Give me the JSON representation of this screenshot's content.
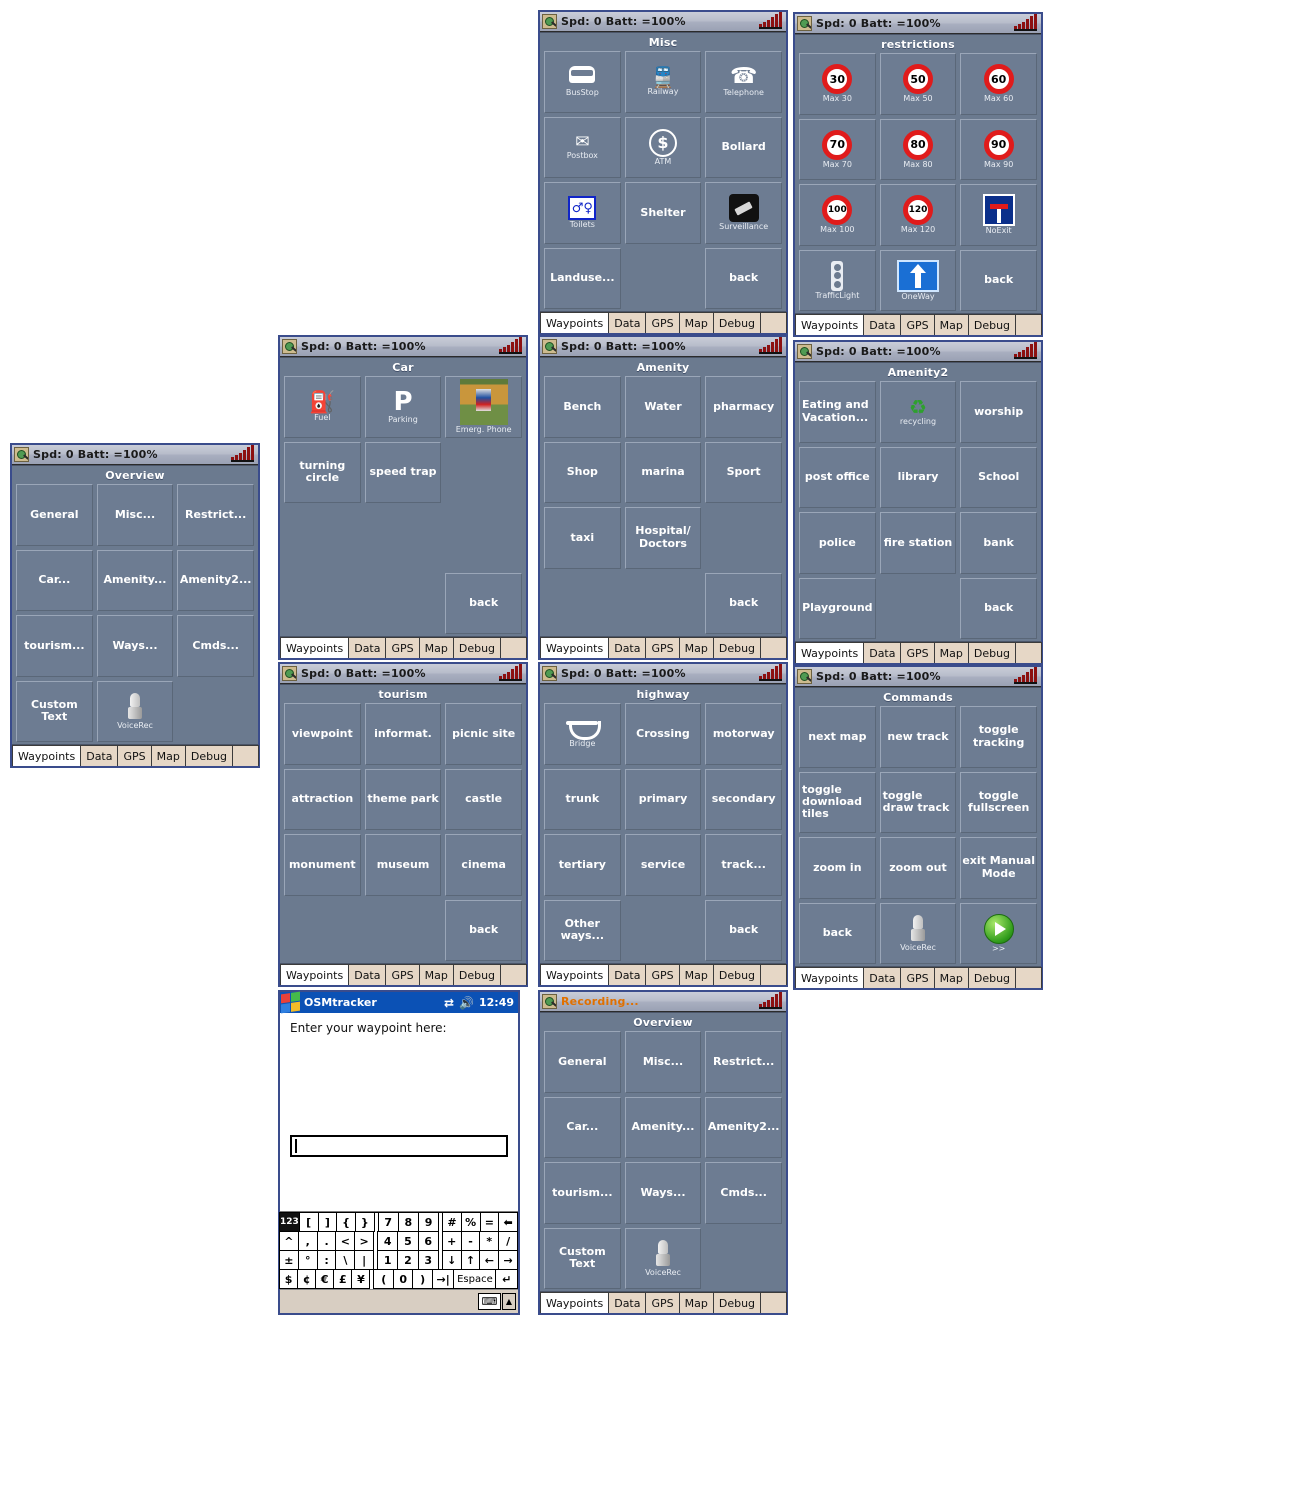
{
  "status": {
    "spd_batt": "Spd: 0 Batt: =100%",
    "recording": "Recording...",
    "signal_icon": "signal-bars-icon",
    "app_icon": "osmtracker-icon"
  },
  "tabs": [
    "Waypoints",
    "Data",
    "GPS",
    "Map",
    "Debug"
  ],
  "panels": {
    "overview": {
      "title": "Overview",
      "buttons": [
        {
          "label": "General"
        },
        {
          "label": "Misc..."
        },
        {
          "label": "Restrict..."
        },
        {
          "label": "Car..."
        },
        {
          "label": "Amenity..."
        },
        {
          "label": "Amenity2..."
        },
        {
          "label": "tourism..."
        },
        {
          "label": "Ways..."
        },
        {
          "label": "Cmds..."
        },
        {
          "label": "Custom Text"
        },
        {
          "label": "",
          "caption": "VoiceRec",
          "icon": "microphone-icon"
        },
        {
          "label": "",
          "empty": true
        }
      ]
    },
    "overview_recording": {
      "title": "Overview",
      "buttons": [
        {
          "label": "General"
        },
        {
          "label": "Misc..."
        },
        {
          "label": "Restrict..."
        },
        {
          "label": "Car..."
        },
        {
          "label": "Amenity..."
        },
        {
          "label": "Amenity2..."
        },
        {
          "label": "tourism..."
        },
        {
          "label": "Ways..."
        },
        {
          "label": "Cmds..."
        },
        {
          "label": "Custom Text"
        },
        {
          "label": "",
          "caption": "VoiceRec",
          "icon": "microphone-icon"
        },
        {
          "label": "",
          "empty": true
        }
      ]
    },
    "misc": {
      "title": "Misc",
      "buttons": [
        {
          "label": "",
          "caption": "BusStop",
          "icon": "bus-icon"
        },
        {
          "label": "",
          "caption": "Railway",
          "icon": "train-icon"
        },
        {
          "label": "",
          "caption": "Telephone",
          "icon": "telephone-icon"
        },
        {
          "label": "",
          "caption": "Postbox",
          "icon": "postbox-icon"
        },
        {
          "label": "",
          "caption": "ATM",
          "icon": "atm-icon"
        },
        {
          "label": "Bollard"
        },
        {
          "label": "",
          "caption": "Toilets",
          "icon": "toilets-icon"
        },
        {
          "label": "Shelter"
        },
        {
          "label": "",
          "caption": "Surveillance",
          "icon": "camera-icon"
        },
        {
          "label": "Landuse..."
        },
        {
          "label": "",
          "empty": true
        },
        {
          "label": "back"
        }
      ]
    },
    "restrictions": {
      "title": "restrictions",
      "buttons": [
        {
          "label": "",
          "caption": "Max 30",
          "icon": "speed-sign-icon",
          "value": "30"
        },
        {
          "label": "",
          "caption": "Max 50",
          "icon": "speed-sign-icon",
          "value": "50"
        },
        {
          "label": "",
          "caption": "Max 60",
          "icon": "speed-sign-icon",
          "value": "60"
        },
        {
          "label": "",
          "caption": "Max 70",
          "icon": "speed-sign-icon",
          "value": "70"
        },
        {
          "label": "",
          "caption": "Max 80",
          "icon": "speed-sign-icon",
          "value": "80"
        },
        {
          "label": "",
          "caption": "Max 90",
          "icon": "speed-sign-icon",
          "value": "90"
        },
        {
          "label": "",
          "caption": "Max 100",
          "icon": "speed-sign-icon",
          "value": "100"
        },
        {
          "label": "",
          "caption": "Max 120",
          "icon": "speed-sign-icon",
          "value": "120"
        },
        {
          "label": "",
          "caption": "NoExit",
          "icon": "no-exit-sign-icon"
        },
        {
          "label": "",
          "caption": "TrafficLight",
          "icon": "traffic-light-icon"
        },
        {
          "label": "",
          "caption": "OneWay",
          "icon": "one-way-sign-icon"
        },
        {
          "label": "back"
        }
      ]
    },
    "car": {
      "title": "Car",
      "buttons": [
        {
          "label": "",
          "caption": "Fuel",
          "icon": "fuel-pump-icon"
        },
        {
          "label": "",
          "caption": "Parking",
          "icon": "parking-icon"
        },
        {
          "label": "",
          "caption": "Emerg. Phone",
          "icon": "emergency-phone-photo-icon"
        },
        {
          "label": "turning circle"
        },
        {
          "label": "speed trap"
        },
        {
          "label": "",
          "empty": true
        },
        {
          "label": "",
          "empty": true
        },
        {
          "label": "",
          "empty": true
        },
        {
          "label": "",
          "empty": true
        },
        {
          "label": "",
          "empty": true
        },
        {
          "label": "",
          "empty": true
        },
        {
          "label": "back"
        }
      ]
    },
    "amenity": {
      "title": "Amenity",
      "buttons": [
        {
          "label": "Bench"
        },
        {
          "label": "Water"
        },
        {
          "label": "pharmacy"
        },
        {
          "label": "Shop"
        },
        {
          "label": "marina"
        },
        {
          "label": "Sport"
        },
        {
          "label": "taxi"
        },
        {
          "label": "Hospital/ Doctors"
        },
        {
          "label": "",
          "empty": true
        },
        {
          "label": "",
          "empty": true
        },
        {
          "label": "",
          "empty": true
        },
        {
          "label": "back"
        }
      ]
    },
    "amenity2": {
      "title": "Amenity2",
      "buttons": [
        {
          "label": "Eating and Vacation...",
          "align": "left"
        },
        {
          "label": "",
          "caption": "recycling",
          "icon": "recycling-icon"
        },
        {
          "label": "worship"
        },
        {
          "label": "post office"
        },
        {
          "label": "library"
        },
        {
          "label": "School"
        },
        {
          "label": "police"
        },
        {
          "label": "fire station"
        },
        {
          "label": "bank"
        },
        {
          "label": "Playground"
        },
        {
          "label": "",
          "empty": true
        },
        {
          "label": "back"
        }
      ]
    },
    "tourism": {
      "title": "tourism",
      "buttons": [
        {
          "label": "viewpoint"
        },
        {
          "label": "informat."
        },
        {
          "label": "picnic site"
        },
        {
          "label": "attraction"
        },
        {
          "label": "theme park"
        },
        {
          "label": "castle"
        },
        {
          "label": "monument"
        },
        {
          "label": "museum"
        },
        {
          "label": "cinema"
        },
        {
          "label": "",
          "empty": true
        },
        {
          "label": "",
          "empty": true
        },
        {
          "label": "back"
        }
      ]
    },
    "highway": {
      "title": "highway",
      "buttons": [
        {
          "label": "",
          "caption": "Bridge",
          "icon": "bridge-icon"
        },
        {
          "label": "Crossing"
        },
        {
          "label": "motorway"
        },
        {
          "label": "trunk"
        },
        {
          "label": "primary"
        },
        {
          "label": "secondary"
        },
        {
          "label": "tertiary"
        },
        {
          "label": "service"
        },
        {
          "label": "track..."
        },
        {
          "label": "Other ways..."
        },
        {
          "label": "",
          "empty": true
        },
        {
          "label": "back"
        }
      ]
    },
    "commands": {
      "title": "Commands",
      "buttons": [
        {
          "label": "next map"
        },
        {
          "label": "new track"
        },
        {
          "label": "toggle tracking"
        },
        {
          "label": "toggle download tiles",
          "align": "left"
        },
        {
          "label": "toggle draw track",
          "align": "left"
        },
        {
          "label": "toggle fullscreen"
        },
        {
          "label": "zoom in"
        },
        {
          "label": "zoom out"
        },
        {
          "label": "exit Manual Mode"
        },
        {
          "label": "back"
        },
        {
          "label": "",
          "caption": "VoiceRec",
          "icon": "microphone-icon"
        },
        {
          "label": "",
          "caption": ">>",
          "icon": "play-button-icon"
        }
      ]
    }
  },
  "osmtracker": {
    "title": "OSMtracker",
    "time": "12:49",
    "connection_icon": "connectivity-icon",
    "speaker_icon": "speaker-icon",
    "prompt": "Enter your waypoint here:",
    "input_value": "",
    "keyboard": {
      "rows": [
        [
          "123",
          "[",
          "]",
          "{",
          "}",
          "7",
          "8",
          "9",
          "#",
          "%",
          "=",
          "⬅"
        ],
        [
          "^",
          ",",
          ".",
          "<",
          ">",
          "4",
          "5",
          "6",
          "+",
          "-",
          "*",
          "/"
        ],
        [
          "±",
          "°",
          ":",
          "\\",
          "|",
          "1",
          "2",
          "3",
          "↓",
          "↑",
          "←",
          "→"
        ],
        [
          "$",
          "¢",
          "€",
          "£",
          "¥",
          "(",
          "0",
          ")",
          "→|",
          "Espace",
          "↵"
        ]
      ],
      "status_icons": [
        "keyboard-icon",
        "up-arrow-icon"
      ]
    }
  }
}
